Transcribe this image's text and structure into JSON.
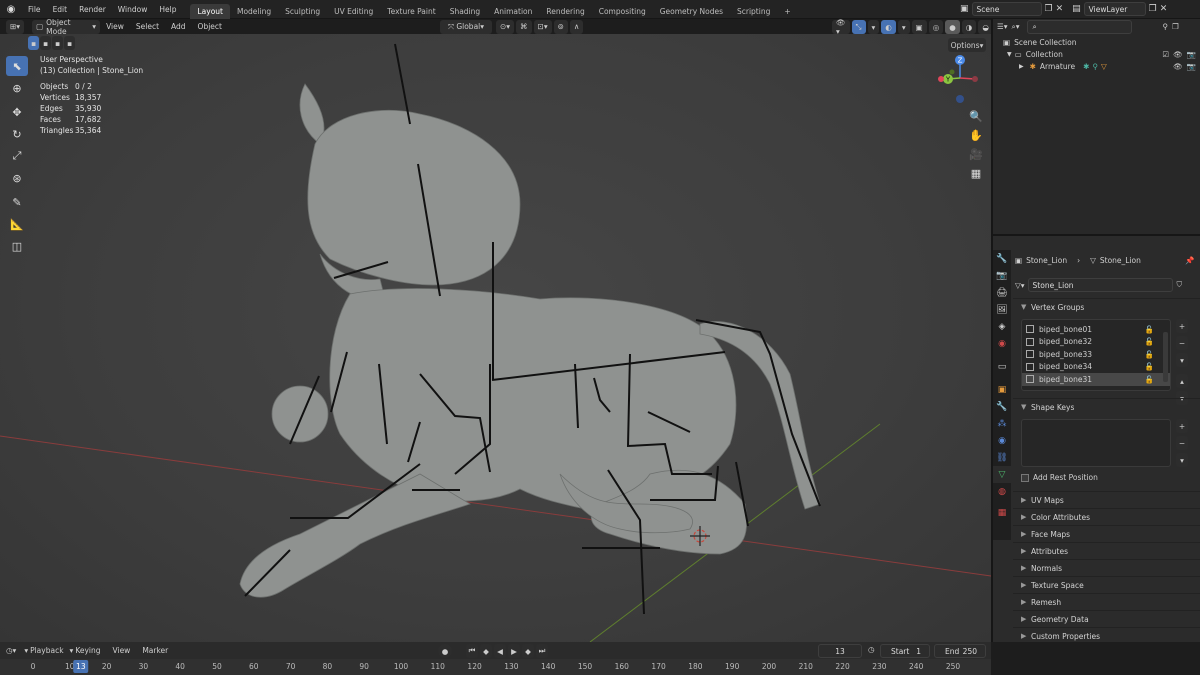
{
  "topbar": {
    "menus": [
      "File",
      "Edit",
      "Render",
      "Window",
      "Help"
    ],
    "workspaces": [
      "Layout",
      "Modeling",
      "Sculpting",
      "UV Editing",
      "Texture Paint",
      "Shading",
      "Animation",
      "Rendering",
      "Compositing",
      "Geometry Nodes",
      "Scripting"
    ],
    "add_tab": "+",
    "scene": "Scene",
    "view_layer": "ViewLayer"
  },
  "viewport_header": {
    "mode": "Object Mode",
    "menus": [
      "View",
      "Select",
      "Add",
      "Object"
    ],
    "transform": "Global",
    "options": "Options"
  },
  "overlay": {
    "title": "User Perspective",
    "subtitle": "(13) Collection | Stone_Lion",
    "stats": [
      {
        "k": "Objects",
        "v": "0 / 2"
      },
      {
        "k": "Vertices",
        "v": "18,357"
      },
      {
        "k": "Edges",
        "v": "35,930"
      },
      {
        "k": "Faces",
        "v": "17,682"
      },
      {
        "k": "Triangles",
        "v": "35,364"
      }
    ]
  },
  "gizmo": {
    "x": "X",
    "y": "Y",
    "z": "Z"
  },
  "outliner": {
    "root": "Scene Collection",
    "collection": "Collection",
    "armature": "Armature"
  },
  "properties": {
    "breadcrumb_obj": "Stone_Lion",
    "breadcrumb_data": "Stone_Lion",
    "mesh_name": "Stone_Lion",
    "vertex_groups_label": "Vertex Groups",
    "vertex_groups": [
      "biped_bone01",
      "biped_bone32",
      "biped_bone33",
      "biped_bone34",
      "biped_bone31"
    ],
    "shape_keys_label": "Shape Keys",
    "add_rest_position": "Add Rest Position",
    "panels": [
      "UV Maps",
      "Color Attributes",
      "Face Maps",
      "Attributes",
      "Normals",
      "Texture Space",
      "Remesh",
      "Geometry Data",
      "Custom Properties"
    ]
  },
  "timeline": {
    "menus": [
      "Playback",
      "Keying",
      "View",
      "Marker"
    ],
    "current_frame": "13",
    "start_label": "Start",
    "start": "1",
    "end_label": "End",
    "end": "250",
    "ticks": [
      "0",
      "10",
      "20",
      "30",
      "40",
      "50",
      "60",
      "70",
      "80",
      "90",
      "100",
      "110",
      "120",
      "130",
      "140",
      "150",
      "160",
      "170",
      "180",
      "190",
      "200",
      "210",
      "220",
      "230",
      "240",
      "250"
    ],
    "playhead": "13"
  },
  "colors": {
    "accent": "#4772b3",
    "x_axis": "#e0465a",
    "y_axis": "#8bc540",
    "z_axis": "#4a8ae8",
    "mesh": "#8f9290"
  }
}
